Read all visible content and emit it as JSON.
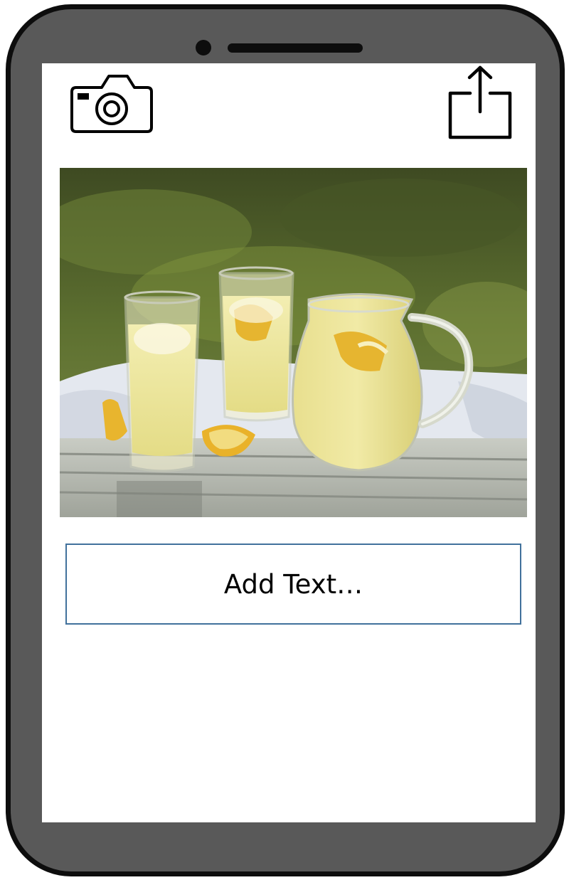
{
  "app": {
    "text_input": {
      "placeholder": "Add Text…",
      "value": ""
    },
    "icons": {
      "camera": "camera-icon",
      "share": "share-icon"
    },
    "colors": {
      "device_body": "#595959",
      "device_outline": "#0d0d0d",
      "input_border": "#41719c"
    }
  }
}
